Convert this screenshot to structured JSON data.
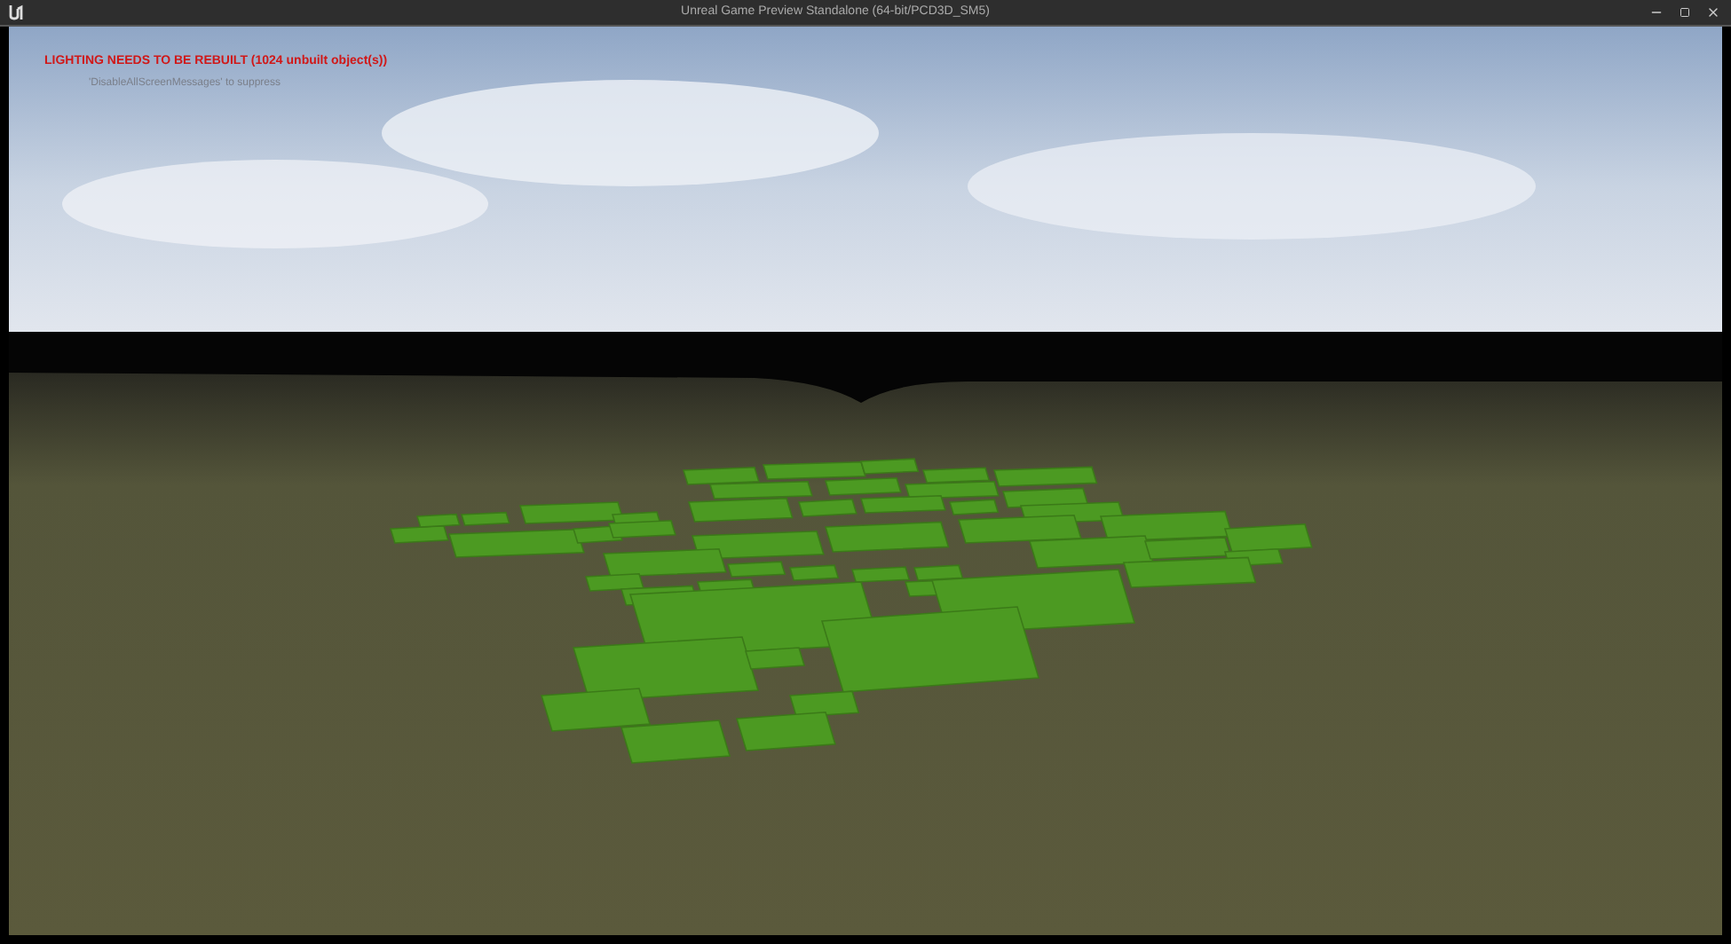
{
  "window": {
    "title": "Unreal Game Preview Standalone (64-bit/PCD3D_SM5)"
  },
  "messages": [
    {
      "kind": "error",
      "text": "LIGHTING NEEDS TO BE REBUILT (1024 unbuilt object(s))"
    },
    {
      "kind": "hint",
      "text": "'DisableAllScreenMessages' to suppress"
    }
  ]
}
